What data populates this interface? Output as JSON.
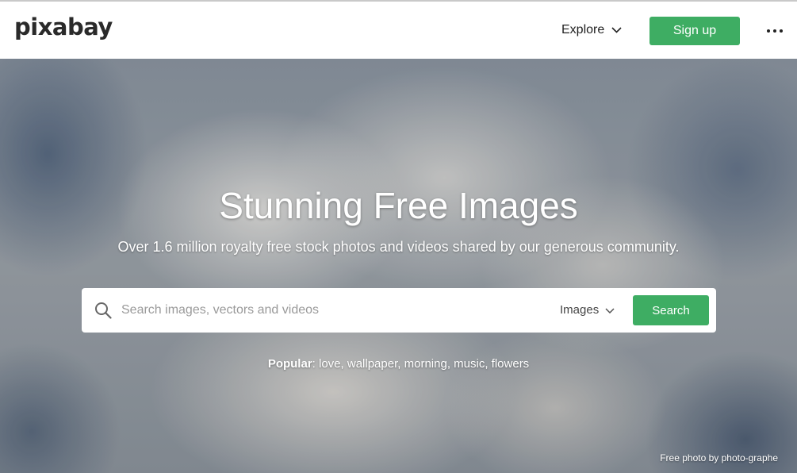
{
  "header": {
    "logo_text": "pixabay",
    "explore_label": "Explore",
    "signup_label": "Sign up"
  },
  "hero": {
    "title": "Stunning Free Images",
    "subtitle": "Over 1.6 million royalty free stock photos and videos shared by our generous community.",
    "search": {
      "placeholder": "Search images, vectors and videos",
      "value": "",
      "type_selected": "Images",
      "button_label": "Search"
    },
    "popular": {
      "label": "Popular",
      "separator": ": ",
      "tags": [
        "love",
        "wallpaper",
        "morning",
        "music",
        "flowers"
      ]
    },
    "credit": {
      "prefix": "Free photo by ",
      "author": "photo-graphe"
    }
  },
  "colors": {
    "accent_green": "#3ead63",
    "header_bg": "#ffffff",
    "text_dark": "#1f1f1f"
  },
  "icons": {
    "explore_chevron": "chevron-down-icon",
    "more_menu": "more-horizontal-icon",
    "search": "search-icon",
    "type_chevron": "chevron-down-icon"
  }
}
